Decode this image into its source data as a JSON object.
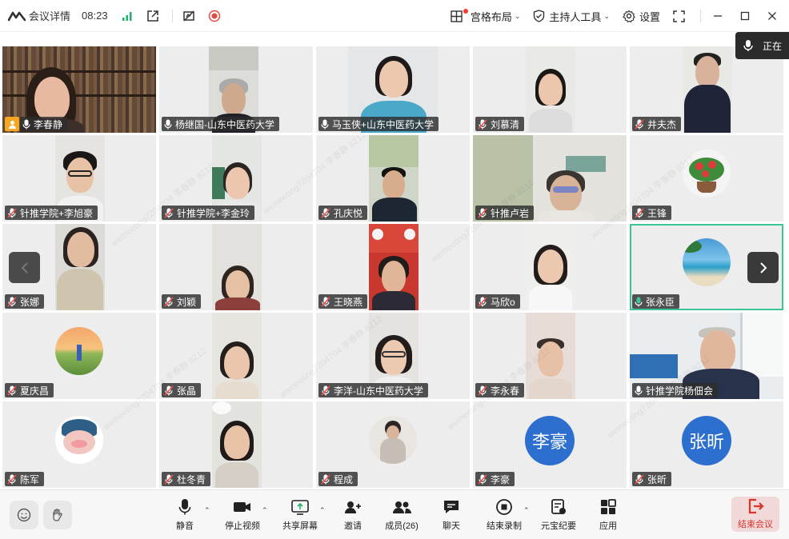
{
  "titlebar": {
    "meeting_details": "会议详情",
    "time": "08:23",
    "grid_layout": "宫格布局",
    "host_tools": "主持人工具",
    "settings": "设置"
  },
  "speaking": {
    "label": "正在"
  },
  "participants": [
    {
      "name": "李春静",
      "mic": "on",
      "host": true
    },
    {
      "name": "杨继国-山东中医药大学",
      "mic": "on"
    },
    {
      "name": "马玉侠+山东中医药大学",
      "mic": "on"
    },
    {
      "name": "刘慕清",
      "mic": "muted"
    },
    {
      "name": "井夫杰",
      "mic": "muted"
    },
    {
      "name": "针推学院+李旭豪",
      "mic": "muted"
    },
    {
      "name": "针推学院+李金玲",
      "mic": "muted"
    },
    {
      "name": "孔庆悦",
      "mic": "muted"
    },
    {
      "name": "针推卢岩",
      "mic": "muted"
    },
    {
      "name": "王锋",
      "mic": "muted"
    },
    {
      "name": "张娜",
      "mic": "muted"
    },
    {
      "name": "刘颖",
      "mic": "muted"
    },
    {
      "name": "王晓燕",
      "mic": "muted"
    },
    {
      "name": "马欣o",
      "mic": "muted"
    },
    {
      "name": "张永臣",
      "mic": "speaking"
    },
    {
      "name": "夏庆昌",
      "mic": "muted"
    },
    {
      "name": "张晶",
      "mic": "muted"
    },
    {
      "name": "李洋-山东中医药大学",
      "mic": "muted"
    },
    {
      "name": "李永春",
      "mic": "muted"
    },
    {
      "name": "针推学院杨佃会",
      "mic": "on"
    },
    {
      "name": "陈军",
      "mic": "muted"
    },
    {
      "name": "杜冬青",
      "mic": "muted"
    },
    {
      "name": "程成",
      "mic": "muted"
    },
    {
      "name": "李豪",
      "mic": "muted",
      "avatar_text": "李豪"
    },
    {
      "name": "张昕",
      "mic": "muted",
      "avatar_text": "张昕"
    }
  ],
  "watermark": "wemeeting7204704 李春静 8212",
  "toolbar": {
    "mute": "静音",
    "stop_video": "停止视频",
    "share_screen": "共享屏幕",
    "invite": "邀请",
    "members": "成员(26)",
    "chat": "聊天",
    "end_recording": "结束录制",
    "yuanbao_notes": "元宝纪要",
    "apps": "应用",
    "end_meeting": "结束会议"
  },
  "colors": {
    "accent_green": "#3dc39a",
    "avatar_blue": "#2c6fcf",
    "end_red": "#d9342b",
    "signal_green": "#20b26b",
    "record_red": "#e5483f"
  }
}
